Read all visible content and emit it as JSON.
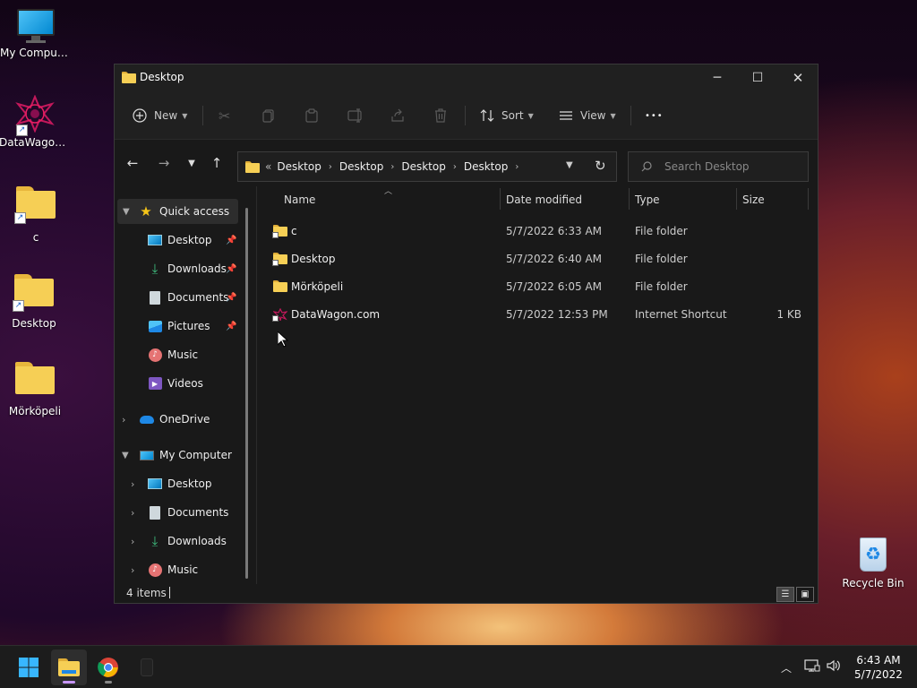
{
  "desktop": {
    "icons": [
      {
        "label": "My Computer",
        "icon": "monitor-icon"
      },
      {
        "label": "DataWagon...",
        "icon": "datawagon-logo-icon"
      },
      {
        "label": "c",
        "icon": "folder-shortcut-icon"
      },
      {
        "label": "Desktop",
        "icon": "folder-shortcut-icon"
      },
      {
        "label": "Mörköpeli",
        "icon": "folder-icon"
      },
      {
        "label": "Recycle Bin",
        "icon": "recycle-bin-icon"
      }
    ]
  },
  "window": {
    "title": "Desktop",
    "controls": {
      "minimize": "─",
      "maximize": "☐",
      "close": "✕"
    }
  },
  "toolbar": {
    "new_label": "New",
    "sort_label": "Sort",
    "view_label": "View",
    "more_label": "•••"
  },
  "address": {
    "overflow": "«",
    "crumbs": [
      "Desktop",
      "Desktop",
      "Desktop",
      "Desktop"
    ],
    "separator": "›"
  },
  "search": {
    "placeholder": "Search Desktop"
  },
  "navpane": {
    "quick_access": "Quick access",
    "quick_items": [
      {
        "label": "Desktop",
        "pinned": true
      },
      {
        "label": "Downloads",
        "pinned": true
      },
      {
        "label": "Documents",
        "pinned": true
      },
      {
        "label": "Pictures",
        "pinned": true
      },
      {
        "label": "Music",
        "pinned": false
      },
      {
        "label": "Videos",
        "pinned": false
      }
    ],
    "onedrive": "OneDrive",
    "my_computer": "My Computer",
    "computer_items": [
      "Desktop",
      "Documents",
      "Downloads",
      "Music"
    ]
  },
  "columns": {
    "name": "Name",
    "date": "Date modified",
    "type": "Type",
    "size": "Size"
  },
  "files": [
    {
      "name": "c",
      "date": "5/7/2022 6:33 AM",
      "type": "File folder",
      "size": "",
      "icon": "folder-shortcut-icon"
    },
    {
      "name": "Desktop",
      "date": "5/7/2022 6:40 AM",
      "type": "File folder",
      "size": "",
      "icon": "folder-shortcut-icon"
    },
    {
      "name": "Mörköpeli",
      "date": "5/7/2022 6:05 AM",
      "type": "File folder",
      "size": "",
      "icon": "folder-icon"
    },
    {
      "name": "DataWagon.com",
      "date": "5/7/2022 12:53 PM",
      "type": "Internet Shortcut",
      "size": "1 KB",
      "icon": "internet-shortcut-icon"
    }
  ],
  "status": {
    "items": "4 items"
  },
  "taskbar": {
    "time": "6:43 AM",
    "date": "5/7/2022"
  },
  "colors": {
    "accent": "#c896ff",
    "folder": "#f6cf55",
    "window_bg": "#191919"
  }
}
